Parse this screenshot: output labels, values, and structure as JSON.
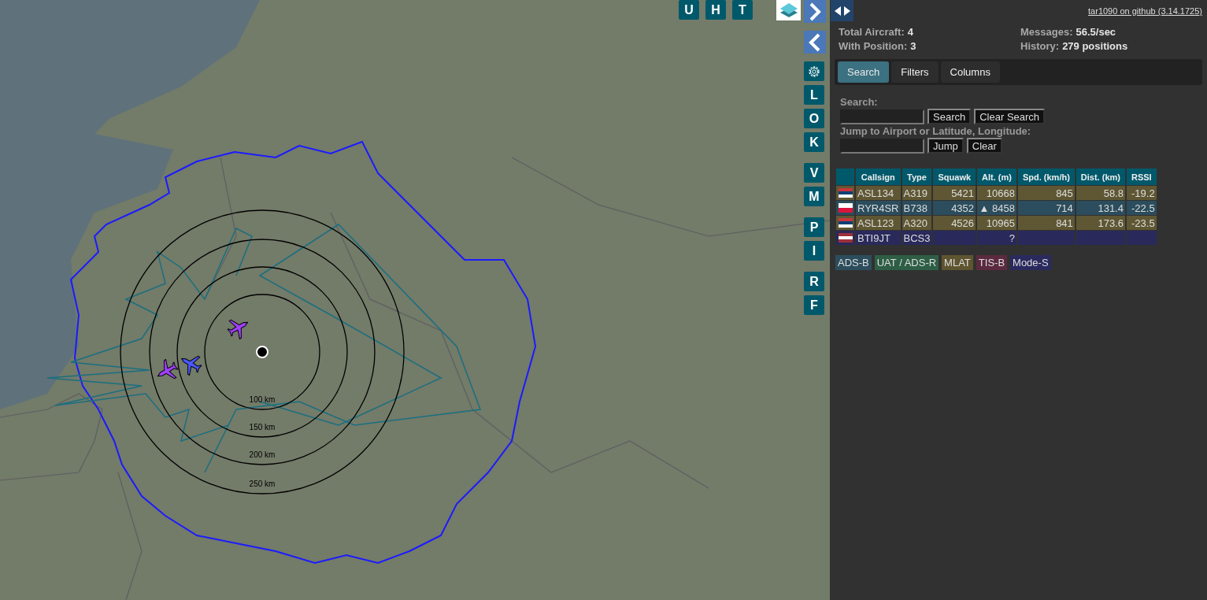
{
  "map": {
    "range_rings": [
      "100 km",
      "150 km",
      "200 km",
      "250 km"
    ],
    "top_buttons": [
      {
        "kind": "letter",
        "label": "U"
      },
      {
        "kind": "letter",
        "label": "H"
      },
      {
        "kind": "letter",
        "label": "T"
      },
      {
        "kind": "layers"
      }
    ],
    "side_groups": [
      [
        {
          "kind": "next"
        },
        {
          "kind": "prev"
        },
        {
          "kind": "settings"
        },
        {
          "kind": "letter",
          "label": "L"
        },
        {
          "kind": "letter",
          "label": "O"
        },
        {
          "kind": "letter",
          "label": "K"
        }
      ],
      [
        {
          "kind": "letter",
          "label": "V"
        },
        {
          "kind": "letter",
          "label": "M"
        }
      ],
      [
        {
          "kind": "letter",
          "label": "P"
        },
        {
          "kind": "letter",
          "label": "I"
        }
      ],
      [
        {
          "kind": "letter",
          "label": "R"
        },
        {
          "kind": "letter",
          "label": "F"
        }
      ]
    ]
  },
  "panel": {
    "github_link": "tar1090 on github (3.14.1725)",
    "stats": [
      {
        "label": "Total Aircraft:",
        "value": "4"
      },
      {
        "label": "Messages:",
        "value": "56.5/sec"
      },
      {
        "label": "With Position:",
        "value": "3"
      },
      {
        "label": "History:",
        "value": "279 positions"
      }
    ],
    "tabs": [
      {
        "label": "Search",
        "selected": true
      },
      {
        "label": "Filters",
        "selected": false
      },
      {
        "label": "Columns",
        "selected": false
      }
    ],
    "search": {
      "label": "Search:",
      "buttons": [
        "Search",
        "Clear Search"
      ]
    },
    "jump": {
      "label": "Jump to Airport or Latitude, Longitude:",
      "buttons": [
        "Jump",
        "Clear"
      ]
    },
    "table": {
      "columns": [
        "Callsign",
        "Type",
        "Squawk",
        "Alt. (m)",
        "Spd. (km/h)",
        "Dist. (km)",
        "RSSI"
      ],
      "rows": [
        {
          "kind": "mlat",
          "flag": [
            {
              "color": "#c6363c"
            },
            {
              "color": "#0c4076"
            },
            {
              "color": "#ffffff"
            }
          ],
          "callsign": "ASL134",
          "type": "A319",
          "squawk": "5421",
          "alt": "10668",
          "speed": "845",
          "dist": "58.8",
          "rssi": "-19.2"
        },
        {
          "kind": "adsb",
          "flag": [
            {
              "color": "#ffffff"
            },
            {
              "color": "#dc143c"
            }
          ],
          "callsign": "RYR4SR",
          "type": "B738",
          "squawk": "4352",
          "alt": "▲ 8458",
          "speed": "714",
          "dist": "131.4",
          "rssi": "-22.5"
        },
        {
          "kind": "mlat",
          "flag": [
            {
              "color": "#c6363c"
            },
            {
              "color": "#0c4076"
            },
            {
              "color": "#ffffff"
            }
          ],
          "callsign": "ASL123",
          "type": "A320",
          "squawk": "4526",
          "alt": "10965",
          "speed": "841",
          "dist": "173.6",
          "rssi": "-23.5"
        },
        {
          "kind": "modes",
          "flag": [
            {
              "color": "#9e3039"
            },
            {
              "color": "#ffffff"
            },
            {
              "color": "#9e3039"
            }
          ],
          "callsign": "BTI9JT",
          "type": "BCS3",
          "alt": "?"
        }
      ]
    },
    "legend": [
      {
        "label": "ADS-B",
        "color": "#2c4d5c"
      },
      {
        "label": "UAT / ADS-R",
        "color": "#2e5e45"
      },
      {
        "label": "MLAT",
        "color": "#5e5530"
      },
      {
        "label": "TIS-B",
        "color": "#5b2a3e"
      },
      {
        "label": "Mode-S",
        "color": "#2a2a5e"
      }
    ]
  }
}
